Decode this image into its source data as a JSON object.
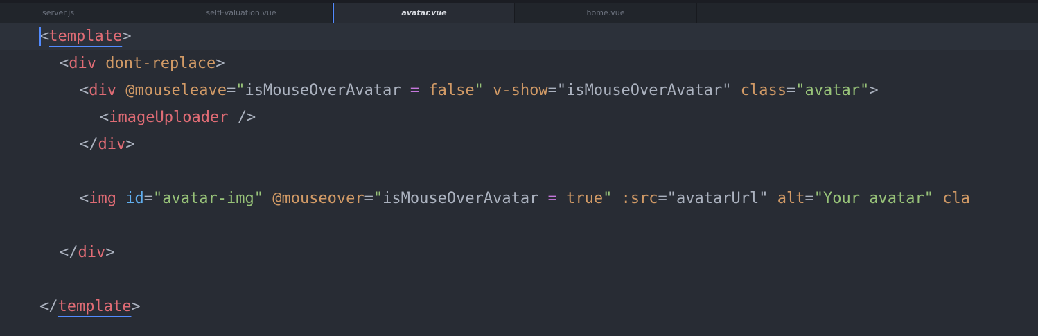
{
  "tabs": [
    {
      "label": "server.js",
      "active": false
    },
    {
      "label": "selfEvaluation.vue",
      "active": false
    },
    {
      "label": "avatar.vue",
      "active": true
    },
    {
      "label": "home.vue",
      "active": false
    }
  ],
  "code": {
    "line1": {
      "lt": "<",
      "tag": "template",
      "gt": ">"
    },
    "line2": {
      "lt": "<",
      "tag": "div",
      "attr": "dont-replace",
      "gt": ">"
    },
    "line3": {
      "lt": "<",
      "tag": "div",
      "a1": "@mouseleave",
      "eq1": "=",
      "q1o": "\"",
      "v1a": "isMouseOverAvatar",
      "v1op": "=",
      "v1b": "false",
      "q1c": "\"",
      "a2": "v-show",
      "eq2": "=",
      "s2": "\"isMouseOverAvatar\"",
      "a3": "class",
      "eq3": "=",
      "s3": "\"avatar\"",
      "gt": ">"
    },
    "line4": {
      "lt": "<",
      "tag": "imageUploader",
      "close": "/>"
    },
    "line5": {
      "lt": "</",
      "tag": "div",
      "gt": ">"
    },
    "line6": {
      "lt": "<",
      "tag": "img",
      "a1": "id",
      "eq1": "=",
      "s1": "\"avatar-img\"",
      "a2": "@mouseover",
      "eq2": "=",
      "q2o": "\"",
      "v2a": "isMouseOverAvatar",
      "v2op": "=",
      "v2b": "true",
      "q2c": "\"",
      "a3": ":src",
      "eq3": "=",
      "s3": "\"avatarUrl\"",
      "a4": "alt",
      "eq4": "=",
      "s4": "\"Your avatar\"",
      "a5": "cla"
    },
    "line7": {
      "lt": "</",
      "tag": "div",
      "gt": ">"
    },
    "line8": {
      "lt": "</",
      "tag": "template",
      "gt": ">"
    }
  }
}
